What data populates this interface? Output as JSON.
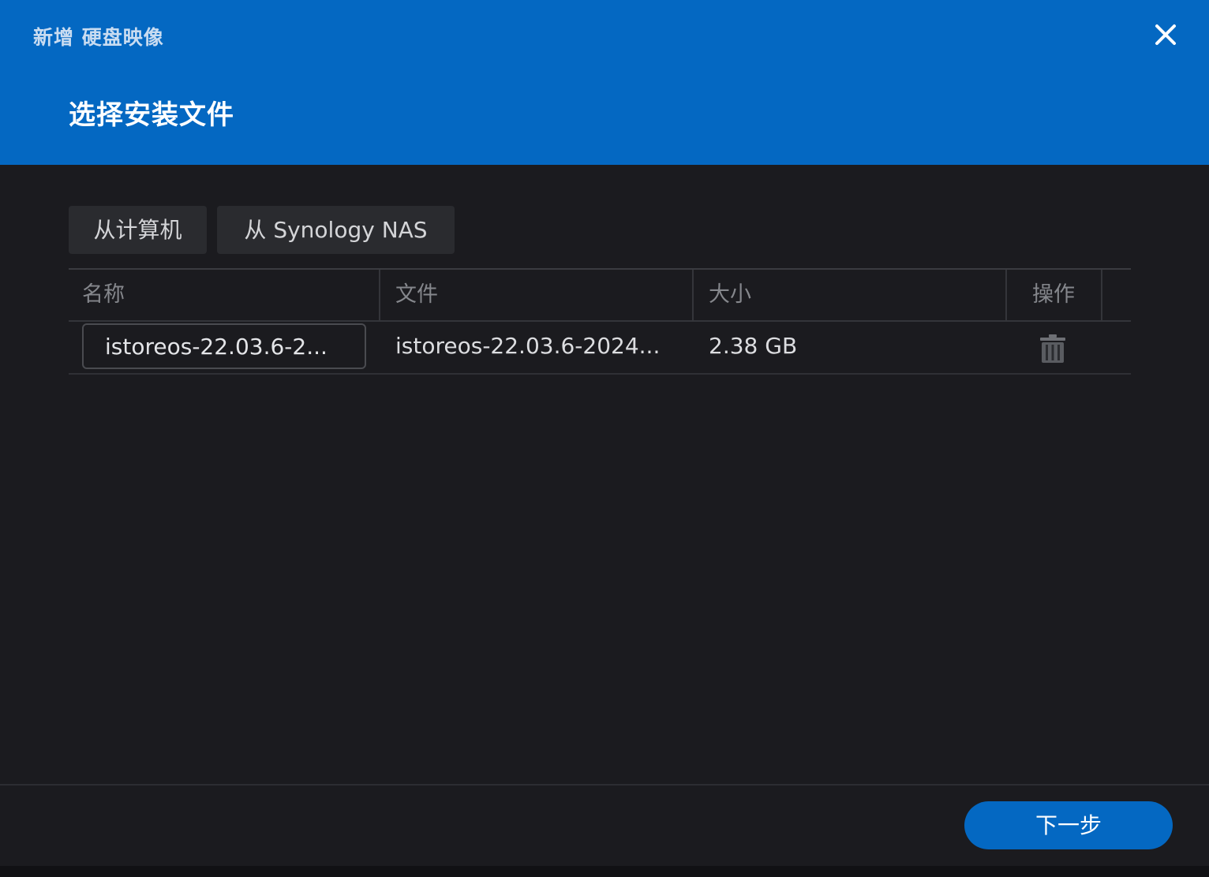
{
  "window": {
    "title": "新增 硬盘映像"
  },
  "step": {
    "title": "选择安装文件"
  },
  "sources": {
    "computer_label": "从计算机",
    "nas_label": "从 Synology NAS"
  },
  "table": {
    "headers": [
      "名称",
      "文件",
      "大小",
      "操作"
    ],
    "rows": [
      {
        "name": "istoreos-22.03.6-2...",
        "file": "istoreos-22.03.6-2024...",
        "size": "2.38 GB"
      }
    ]
  },
  "footer": {
    "next_label": "下一步"
  },
  "colors": {
    "header_bg": "#0468c2",
    "body_bg": "#1b1b1f",
    "primary_button": "#0468c2"
  },
  "icons": {
    "close": "close-icon",
    "delete": "trash-icon"
  }
}
